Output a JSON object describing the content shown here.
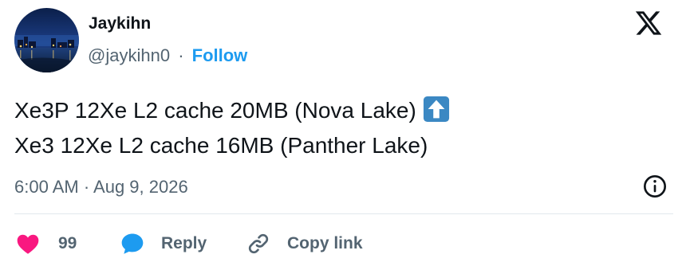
{
  "author": {
    "name": "Jaykihn",
    "handle": "@jaykihn0",
    "separator": "·",
    "follow_label": "Follow"
  },
  "tweet": {
    "lines": [
      "Xe3P 12Xe L2 cache 20MB (Nova Lake)",
      "Xe3 12Xe L2 cache 16MB (Panther Lake)"
    ],
    "emoji": "up-arrow-button-emoji",
    "timestamp": "6:00 AM · Aug 9, 2026"
  },
  "actions": {
    "likes_count": "99",
    "reply_label": "Reply",
    "copy_link_label": "Copy link"
  },
  "icons": {
    "platform": "x-logo-icon",
    "info": "info-icon",
    "like": "heart-icon",
    "reply": "speech-bubble-icon",
    "copy": "link-icon"
  },
  "colors": {
    "accent": "#1d9bf0",
    "like": "#f91880",
    "text": "#0f1419",
    "muted": "#536471",
    "divider": "#e1e8ed"
  }
}
